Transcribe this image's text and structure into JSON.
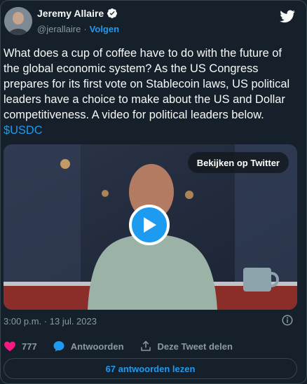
{
  "author": {
    "name": "Jeremy Allaire",
    "handle": "@jerallaire",
    "separator": "·",
    "follow_label": "Volgen"
  },
  "tweet": {
    "text": "What does a cup of coffee have to do with the future of the global economic system?  As the US Congress prepares for its first vote on Stablecoin laws, US political leaders have a choice to make about the US and Dollar competitiveness.  A video for political leaders below. ",
    "cashtag": "$USDC"
  },
  "video": {
    "watch_label": "Bekijken op Twitter"
  },
  "meta": {
    "timestamp": "3:00 p.m. · 13 jul. 2023"
  },
  "actions": {
    "like_count": "777",
    "reply_label": "Antwoorden",
    "share_label": "Deze Tweet delen"
  },
  "read_replies_label": "67 antwoorden lezen",
  "colors": {
    "background": "#15202b",
    "accent": "#1d9bf0",
    "like": "#f91880",
    "muted": "#8b98a5"
  }
}
